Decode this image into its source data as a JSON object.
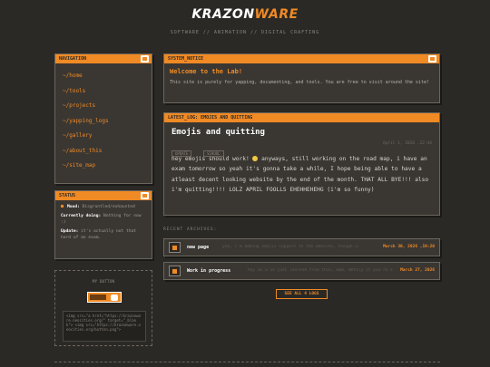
{
  "header": {
    "logo_a": "KRAZON",
    "logo_b": "WARE",
    "tagline": "SOFTWARE // ANIMATION // DIGITAL CRAFTING"
  },
  "navigation": {
    "title": "NAVIGATION",
    "items": [
      {
        "label": "~/home"
      },
      {
        "label": "~/tools"
      },
      {
        "label": "~/projects"
      },
      {
        "label": "~/yapping_logs"
      },
      {
        "label": "~/gallery"
      },
      {
        "label": "~/about_this"
      },
      {
        "label": "~/site_map"
      }
    ]
  },
  "status": {
    "title": "STATUS",
    "mood_label": "Mood:",
    "mood_value": "Disgruntled/exhausted",
    "doing_label": "Currently doing:",
    "doing_value": "Nothing for now :)",
    "update_label": "Update:",
    "update_value": "it's actually not that hard of an exam."
  },
  "my_button": {
    "title": "MY BUTTON",
    "code": "<img src=\"a href=\"https://krazonware.neocities.org/\" target=\"_blank\"> <img src=\"https://krazonware.neocities.org/button.png\">"
  },
  "system_notice": {
    "title": "SYSTEM_NOTICE",
    "heading": "Welcome to the Lab!",
    "text": "This site is purely for yapping, documenting, and tools. You are free to visit around the site!"
  },
  "latest_log": {
    "title": "LATEST_LOG: EMOJIS AND QUITTING",
    "post_title": "Emojis and quitting",
    "tags": [
      "UPDATE",
      "SCHOOL"
    ],
    "date": "April 1, 2026 ,22:44",
    "text_1": "hey emojis should work!",
    "text_2": " anyways, still working on the road map, i have an exam tomorrow so yeah it's gonna take a while, I hope being able to have a atleast decent looking website by the end of the month. THAT ALL BYE!!! also i'm quitting!!!! LOLZ APRIL FOOLLS EHEHHEHEHG (i'm so funny)"
  },
  "archives": {
    "label": "RECENT ARCHIVES:",
    "items": [
      {
        "title": "new page",
        "excerpt": "yea, i'm adding emojis support to the website, though using...",
        "date": "March 30, 2026 ,19:20"
      },
      {
        "title": "Work in progress",
        "excerpt": "hey as u've just learned from this, emm, Nettly if you're strolling...",
        "date": "March 27, 2026"
      }
    ],
    "see_all": "SEE ALL 4 LOGS"
  },
  "colors": {
    "accent": "#f08a24",
    "background": "#2b2926",
    "panel": "#3a3733"
  }
}
